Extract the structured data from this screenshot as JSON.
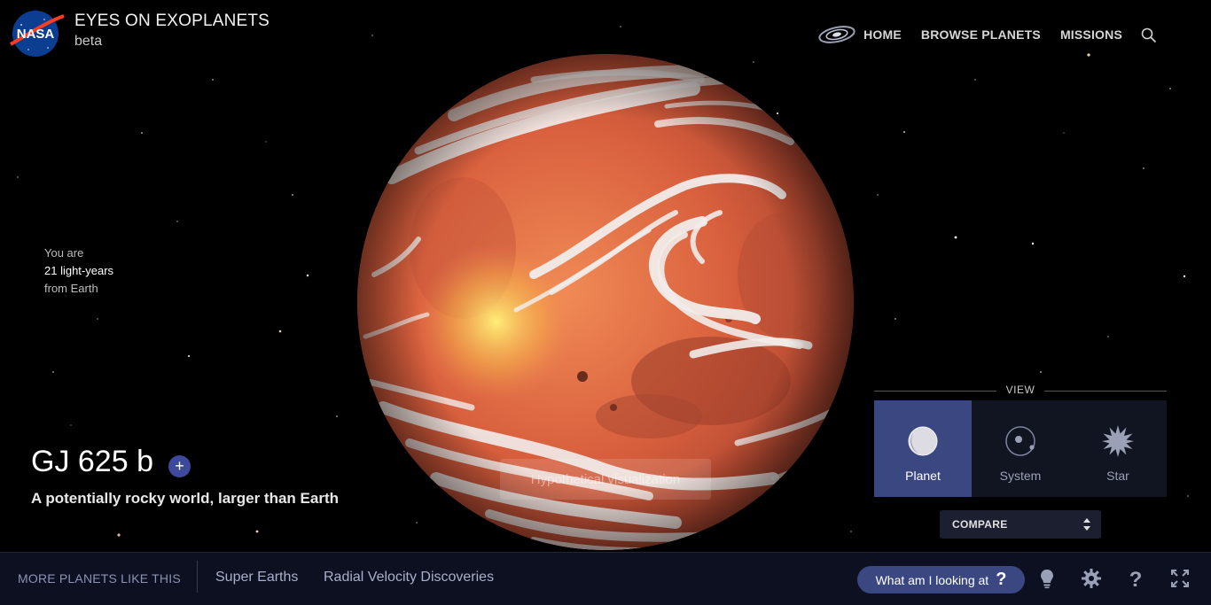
{
  "header": {
    "logo_text": "NASA",
    "title": "EYES ON EXOPLANETS",
    "subtitle": "beta"
  },
  "nav": {
    "items": [
      {
        "label": "HOME",
        "icon": "galaxy-icon"
      },
      {
        "label": "BROWSE PLANETS"
      },
      {
        "label": "MISSIONS"
      }
    ],
    "search_icon": "search-icon"
  },
  "distance": {
    "line1": "You are",
    "line2": "21 light-years",
    "line3": "from Earth"
  },
  "planet": {
    "name": "GJ 625 b",
    "add_label": "+",
    "description": "A potentially rocky world, larger than Earth",
    "visualization_note": "Hypothetical visualization"
  },
  "view": {
    "label": "VIEW",
    "options": [
      {
        "label": "Planet",
        "icon": "planet-icon",
        "active": true
      },
      {
        "label": "System",
        "icon": "system-icon",
        "active": false
      },
      {
        "label": "Star",
        "icon": "star-icon",
        "active": false
      }
    ],
    "compare_label": "COMPARE"
  },
  "bottombar": {
    "more_label": "MORE PLANETS LIKE THIS",
    "links": [
      "Super Earths",
      "Radial Velocity Discoveries"
    ],
    "looking_label": "What am I looking at",
    "looking_icon": "question",
    "icons": [
      "lightbulb-icon",
      "gear-icon",
      "help-icon",
      "fullscreen-icon"
    ]
  },
  "colors": {
    "background": "#000000",
    "accent": "#3b4780",
    "bar": "#0d1020",
    "planet_base": "#d9603e"
  }
}
